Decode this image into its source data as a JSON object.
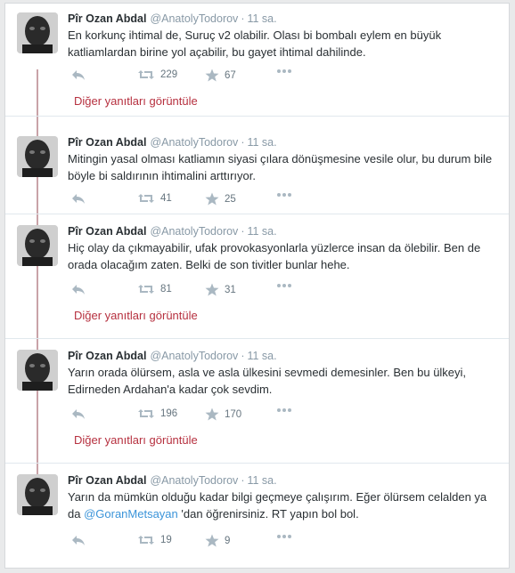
{
  "tweets": [
    {
      "name": "Pîr Ozan Abdal",
      "handle": "@AnatolyTodorov",
      "dot": "·",
      "time": "11 sa.",
      "text": "En korkunç ihtimal de, Suruç v2 olabilir. Olası bi bombalı eylem en büyük katliamlardan birine yol açabilir, bu gayet ihtimal dahilinde.",
      "retweets": "229",
      "favorites": "67",
      "more_replies": "Diğer yanıtları görüntüle"
    },
    {
      "name": "Pîr Ozan Abdal",
      "handle": "@AnatolyTodorov",
      "dot": "·",
      "time": "11 sa.",
      "text": "Mitingin yasal olması katliamın siyasi çılara dönüşmesine vesile olur, bu durum bile böyle bi saldırının ihtimalini arttırıyor.",
      "retweets": "41",
      "favorites": "25"
    },
    {
      "name": "Pîr Ozan Abdal",
      "handle": "@AnatolyTodorov",
      "dot": "·",
      "time": "11 sa.",
      "text": "Hiç olay da çıkmayabilir, ufak provokasyonlarla yüzlerce insan da ölebilir. Ben de orada olacağım zaten. Belki de son tivitler bunlar hehe.",
      "retweets": "81",
      "favorites": "31",
      "more_replies": "Diğer yanıtları görüntüle"
    },
    {
      "name": "Pîr Ozan Abdal",
      "handle": "@AnatolyTodorov",
      "dot": "·",
      "time": "11 sa.",
      "text": "Yarın orada ölürsem, asla ve asla ülkesini sevmedi demesinler. Ben bu ülkeyi, Edirneden Ardahan'a kadar çok sevdim.",
      "retweets": "196",
      "favorites": "170",
      "more_replies": "Diğer yanıtları görüntüle"
    },
    {
      "name": "Pîr Ozan Abdal",
      "handle": "@AnatolyTodorov",
      "dot": "·",
      "time": "11 sa.",
      "text_before": "Yarın da mümkün olduğu kadar bilgi geçmeye çalışırım. Eğer ölürsem celalden ya da ",
      "mention": "@GoranMetsayan",
      "text_after": " 'dan öğrenirsiniz. RT yapın bol bol.",
      "retweets": "19",
      "favorites": "9"
    }
  ],
  "icons": {
    "reply": "reply-icon",
    "retweet": "retweet-icon",
    "favorite": "star-icon",
    "more": "more-icon"
  },
  "colors": {
    "link": "#3b94d9",
    "more_replies": "#b6303f",
    "thread_line": "#c9a3a8",
    "icon_gray": "#aab8c2"
  }
}
